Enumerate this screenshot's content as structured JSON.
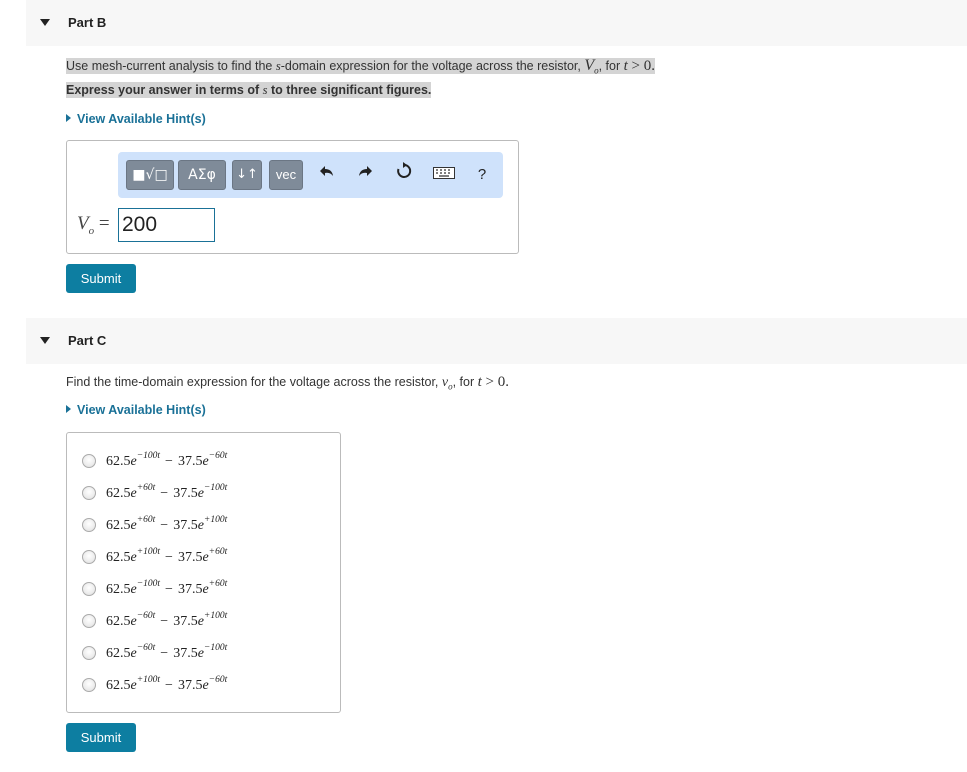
{
  "partB": {
    "title": "Part B",
    "question": {
      "t1": "Use mesh-current analysis to find the ",
      "s": "s",
      "t2": "-domain expression for the voltage across the resistor, ",
      "V": "V",
      "sub": "o",
      "t3": ", for ",
      "t": "t",
      "gt": " > 0."
    },
    "instruction": {
      "t1": "Express your answer in terms of ",
      "s": "s",
      "t2": " to three significant figures."
    },
    "hint_label": "View Available Hint(s)",
    "toolbar": {
      "templates_icon": "■√□",
      "greek_label": "ΑΣφ",
      "arrows_label": "↓↑",
      "vec_label": "vec",
      "undo_icon": "undo-icon",
      "redo_icon": "redo-icon",
      "reset_icon": "reset-icon",
      "keyboard_icon": "keyboard-icon",
      "help_label": "?"
    },
    "answer_label": {
      "V": "V",
      "sub": "o",
      "eq": " ="
    },
    "answer_value": "200",
    "submit_label": "Submit"
  },
  "partC": {
    "title": "Part C",
    "question": {
      "t1": "Find the time-domain expression for the voltage across the resistor, ",
      "v": "v",
      "sub": "o",
      "t2": ", for ",
      "t": "t",
      "gt": " > 0."
    },
    "hint_label": "View Available Hint(s)",
    "options": [
      {
        "c1": "62.5",
        "e1": "−100t",
        "c2": "37.5",
        "e2": "−60t"
      },
      {
        "c1": "62.5",
        "e1": "+60t",
        "c2": "37.5",
        "e2": "−100t"
      },
      {
        "c1": "62.5",
        "e1": "+60t",
        "c2": "37.5",
        "e2": "+100t"
      },
      {
        "c1": "62.5",
        "e1": "+100t",
        "c2": "37.5",
        "e2": "+60t"
      },
      {
        "c1": "62.5",
        "e1": "−100t",
        "c2": "37.5",
        "e2": "+60t"
      },
      {
        "c1": "62.5",
        "e1": "−60t",
        "c2": "37.5",
        "e2": "+100t"
      },
      {
        "c1": "62.5",
        "e1": "−60t",
        "c2": "37.5",
        "e2": "−100t"
      },
      {
        "c1": "62.5",
        "e1": "+100t",
        "c2": "37.5",
        "e2": "−60t"
      }
    ],
    "submit_label": "Submit"
  }
}
